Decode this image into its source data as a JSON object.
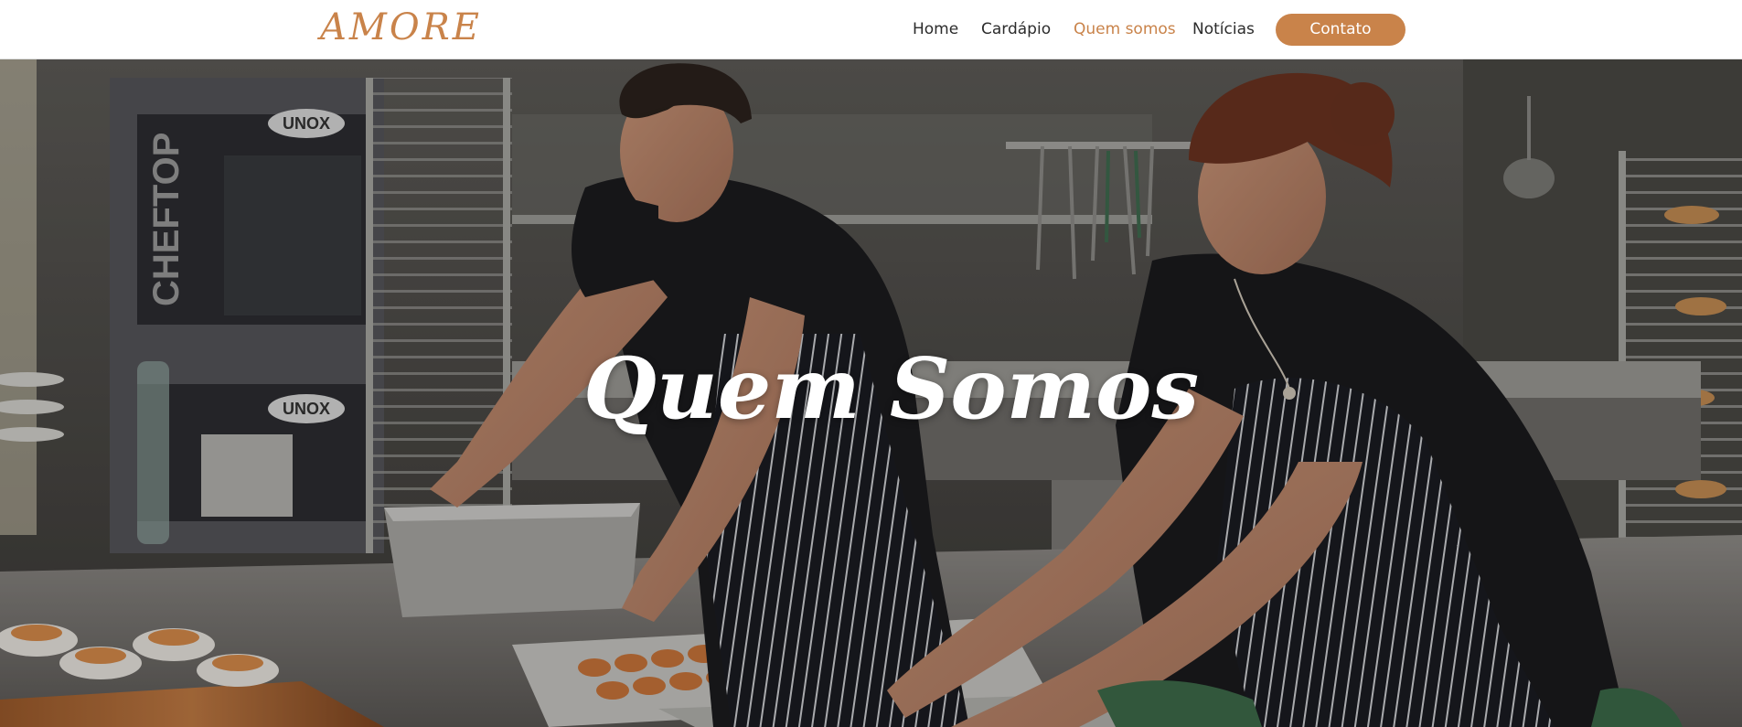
{
  "header": {
    "logo": "AMORE",
    "nav": {
      "home": "Home",
      "cardapio": "Cardápio",
      "quem_somos": "Quem somos",
      "noticias": "Notícias",
      "contato": "Contato"
    },
    "active_item": "Quem somos"
  },
  "hero": {
    "title": "Quem Somos",
    "image": "kitchen-photo",
    "oven_brand_labels": [
      "UNOX",
      "UNOX"
    ],
    "oven_vertical_label": "CHEFTOP"
  },
  "colors": {
    "accent": "#c9834a",
    "nav_text": "#2c2c2c",
    "header_bg": "#ffffff"
  }
}
